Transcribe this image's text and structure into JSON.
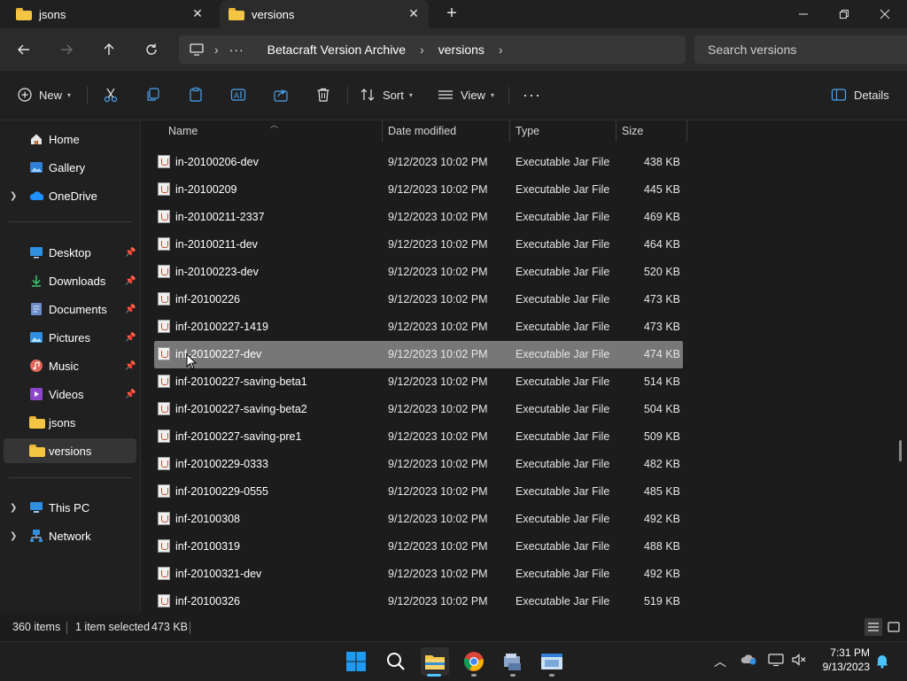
{
  "tabs": [
    {
      "label": "jsons",
      "active": false
    },
    {
      "label": "versions",
      "active": true
    }
  ],
  "address": {
    "crumbs": [
      "Betacraft Version Archive",
      "versions"
    ],
    "search_placeholder": "Search versions"
  },
  "toolbar": {
    "new_label": "New",
    "sort_label": "Sort",
    "view_label": "View",
    "more_label": "···",
    "details_label": "Details"
  },
  "sidebar": {
    "items": [
      {
        "label": "Home"
      },
      {
        "label": "Gallery"
      },
      {
        "label": "OneDrive"
      },
      {
        "label": "Desktop"
      },
      {
        "label": "Downloads"
      },
      {
        "label": "Documents"
      },
      {
        "label": "Pictures"
      },
      {
        "label": "Music"
      },
      {
        "label": "Videos"
      },
      {
        "label": "jsons"
      },
      {
        "label": "versions"
      },
      {
        "label": "This PC"
      },
      {
        "label": "Network"
      }
    ]
  },
  "columns": {
    "name": "Name",
    "date": "Date modified",
    "type": "Type",
    "size": "Size"
  },
  "files": [
    {
      "name": "in-20100206-dev",
      "date": "9/12/2023 10:02 PM",
      "type": "Executable Jar File",
      "size": "438 KB"
    },
    {
      "name": "in-20100209",
      "date": "9/12/2023 10:02 PM",
      "type": "Executable Jar File",
      "size": "445 KB"
    },
    {
      "name": "in-20100211-2337",
      "date": "9/12/2023 10:02 PM",
      "type": "Executable Jar File",
      "size": "469 KB"
    },
    {
      "name": "in-20100211-dev",
      "date": "9/12/2023 10:02 PM",
      "type": "Executable Jar File",
      "size": "464 KB"
    },
    {
      "name": "in-20100223-dev",
      "date": "9/12/2023 10:02 PM",
      "type": "Executable Jar File",
      "size": "520 KB"
    },
    {
      "name": "inf-20100226",
      "date": "9/12/2023 10:02 PM",
      "type": "Executable Jar File",
      "size": "473 KB"
    },
    {
      "name": "inf-20100227-1419",
      "date": "9/12/2023 10:02 PM",
      "type": "Executable Jar File",
      "size": "473 KB"
    },
    {
      "name": "inf-20100227-dev",
      "date": "9/12/2023 10:02 PM",
      "type": "Executable Jar File",
      "size": "474 KB"
    },
    {
      "name": "inf-20100227-saving-beta1",
      "date": "9/12/2023 10:02 PM",
      "type": "Executable Jar File",
      "size": "514 KB"
    },
    {
      "name": "inf-20100227-saving-beta2",
      "date": "9/12/2023 10:02 PM",
      "type": "Executable Jar File",
      "size": "504 KB"
    },
    {
      "name": "inf-20100227-saving-pre1",
      "date": "9/12/2023 10:02 PM",
      "type": "Executable Jar File",
      "size": "509 KB"
    },
    {
      "name": "inf-20100229-0333",
      "date": "9/12/2023 10:02 PM",
      "type": "Executable Jar File",
      "size": "482 KB"
    },
    {
      "name": "inf-20100229-0555",
      "date": "9/12/2023 10:02 PM",
      "type": "Executable Jar File",
      "size": "485 KB"
    },
    {
      "name": "inf-20100308",
      "date": "9/12/2023 10:02 PM",
      "type": "Executable Jar File",
      "size": "492 KB"
    },
    {
      "name": "inf-20100319",
      "date": "9/12/2023 10:02 PM",
      "type": "Executable Jar File",
      "size": "488 KB"
    },
    {
      "name": "inf-20100321-dev",
      "date": "9/12/2023 10:02 PM",
      "type": "Executable Jar File",
      "size": "492 KB"
    },
    {
      "name": "inf-20100326",
      "date": "9/12/2023 10:02 PM",
      "type": "Executable Jar File",
      "size": "519 KB"
    }
  ],
  "selected_index": 7,
  "status": {
    "item_count": "360 items",
    "selection": "1 item selected",
    "selection_size": "473 KB"
  },
  "clock": {
    "time": "7:31 PM",
    "date": "9/13/2023"
  },
  "colors": {
    "accent": "#0078d4",
    "folder": "#f4c542",
    "selection": "#777777"
  }
}
